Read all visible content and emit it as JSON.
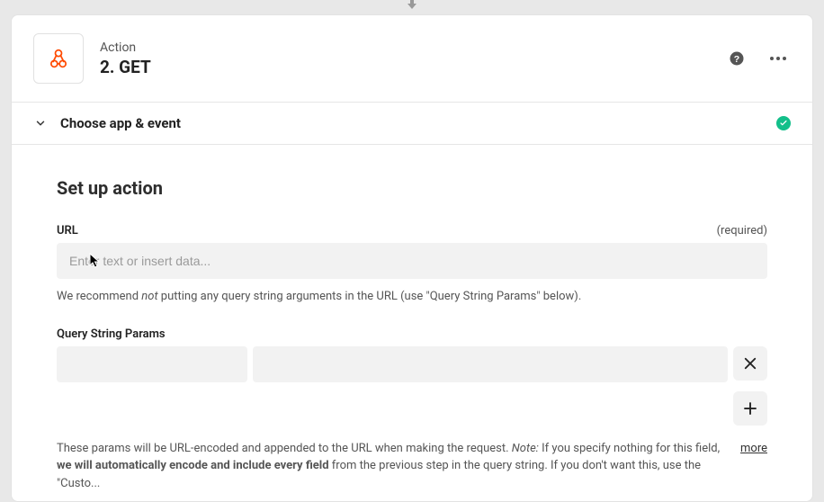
{
  "header": {
    "subtitle": "Action",
    "title": "2. GET"
  },
  "section": {
    "label": "Choose app & event"
  },
  "setup": {
    "heading": "Set up action",
    "url": {
      "label": "URL",
      "required_text": "(required)",
      "placeholder": "Enter text or insert data...",
      "helper_pre": "We recommend ",
      "helper_em": "not",
      "helper_post": " putting any query string arguments in the URL (use \"Query String Params\" below)."
    },
    "qsp": {
      "label": "Query String Params",
      "helper_a": "These params will be URL-encoded and appended to the URL when making the request. ",
      "helper_b": "Note:",
      "helper_c": " If you specify nothing for this field, ",
      "helper_d": "we will automatically encode and include every field",
      "helper_e": " from the previous step in the query string. If you don't want this, use the \"Custo...",
      "more": "more"
    }
  }
}
